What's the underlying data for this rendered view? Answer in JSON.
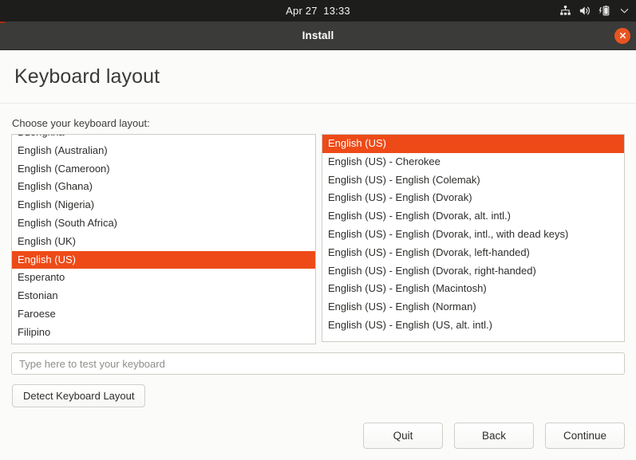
{
  "topbar": {
    "clock": "Apr 27  13:33",
    "icons": [
      "network-icon",
      "volume-icon",
      "battery-charging-icon",
      "chevron-down-icon"
    ]
  },
  "window": {
    "title": "Install",
    "close_icon": "close-icon"
  },
  "page": {
    "heading": "Keyboard layout",
    "prompt": "Choose your keyboard layout:"
  },
  "language_list": {
    "selected": "English (US)",
    "partial_top": true,
    "items": [
      "Dzongkha",
      "English (Australian)",
      "English (Cameroon)",
      "English (Ghana)",
      "English (Nigeria)",
      "English (South Africa)",
      "English (UK)",
      "English (US)",
      "Esperanto",
      "Estonian",
      "Faroese",
      "Filipino"
    ]
  },
  "variant_list": {
    "selected": "English (US)",
    "items": [
      "English (US)",
      "English (US) - Cherokee",
      "English (US) - English (Colemak)",
      "English (US) - English (Dvorak)",
      "English (US) - English (Dvorak, alt. intl.)",
      "English (US) - English (Dvorak, intl., with dead keys)",
      "English (US) - English (Dvorak, left-handed)",
      "English (US) - English (Dvorak, right-handed)",
      "English (US) - English (Macintosh)",
      "English (US) - English (Norman)",
      "English (US) - English (US, alt. intl.)"
    ]
  },
  "test_input": {
    "value": "",
    "placeholder": "Type here to test your keyboard"
  },
  "detect_button": {
    "label": "Detect Keyboard Layout"
  },
  "footer": {
    "quit": "Quit",
    "back": "Back",
    "continue": "Continue"
  },
  "colors": {
    "accent": "#e95420",
    "selection": "#ee4a18",
    "titlebar": "#3b3b39",
    "topbar": "#1d1d1b",
    "page_bg": "#fbfbfa"
  }
}
